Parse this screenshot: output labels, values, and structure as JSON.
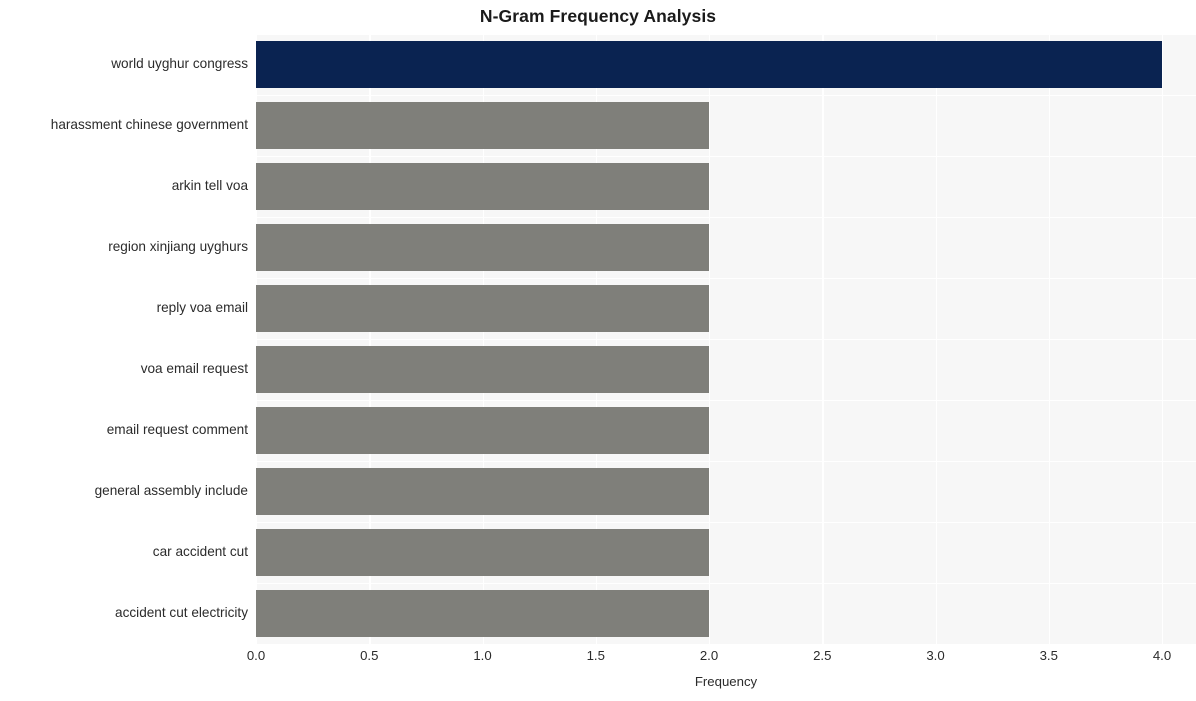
{
  "chart_data": {
    "type": "bar",
    "orientation": "horizontal",
    "title": "N-Gram Frequency Analysis",
    "xlabel": "Frequency",
    "ylabel": "",
    "categories": [
      "world uyghur congress",
      "harassment chinese government",
      "arkin tell voa",
      "region xinjiang uyghurs",
      "reply voa email",
      "voa email request",
      "email request comment",
      "general assembly include",
      "car accident cut",
      "accident cut electricity"
    ],
    "values": [
      4,
      2,
      2,
      2,
      2,
      2,
      2,
      2,
      2,
      2
    ],
    "bar_colors": [
      "#0a2351",
      "#7f7f7a",
      "#7f7f7a",
      "#7f7f7a",
      "#7f7f7a",
      "#7f7f7a",
      "#7f7f7a",
      "#7f7f7a",
      "#7f7f7a",
      "#7f7f7a"
    ],
    "xlim": [
      0,
      4.15
    ],
    "xticks": [
      0,
      0.5,
      1,
      1.5,
      2,
      2.5,
      3,
      3.5,
      4
    ],
    "xtick_labels": [
      "0.0",
      "0.5",
      "1.0",
      "1.5",
      "2.0",
      "2.5",
      "3.0",
      "3.5",
      "4.0"
    ],
    "grid": true,
    "grid_color": "#ffffff",
    "plot_background": "#f7f7f7",
    "figure_background": "#ffffff",
    "legend": null,
    "highlight_color": "#0a2351",
    "default_color": "#7f7f7a"
  }
}
